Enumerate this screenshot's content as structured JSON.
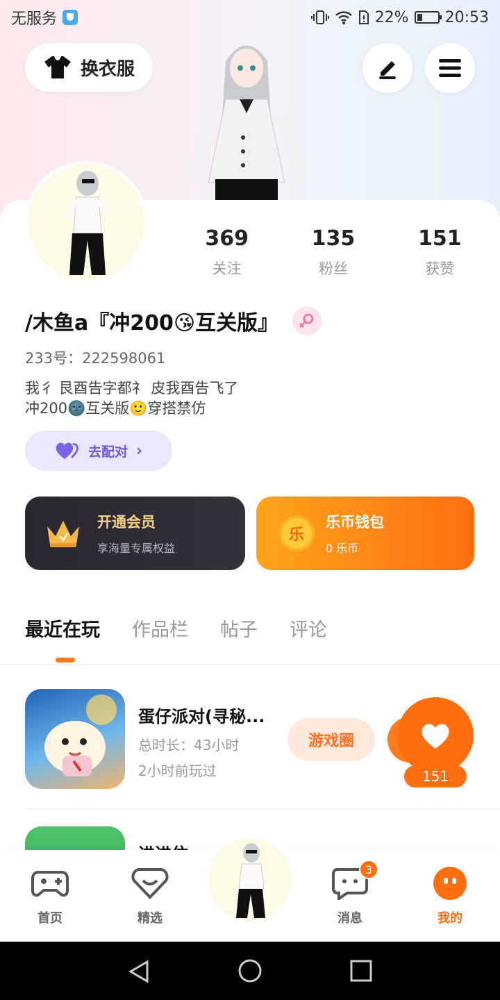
{
  "status_bar": {
    "carrier": "无服务",
    "battery": "22%",
    "time": "20:53"
  },
  "header": {
    "outfit_label": "换衣服"
  },
  "stats": [
    {
      "num": "369",
      "label": "关注"
    },
    {
      "num": "135",
      "label": "粉丝"
    },
    {
      "num": "151",
      "label": "获赞"
    }
  ],
  "profile": {
    "nickname": "/木鱼a『冲200😘互关版』",
    "uid": "233号：222598061",
    "bio_line1": "我彳 艮酉告字都礻 皮我酉告飞了",
    "bio_line2": "冲200🌚互关版🙂穿搭禁仿",
    "pair_label": "去配对"
  },
  "cards": {
    "vip_title": "开通会员",
    "vip_sub": "享海量专属权益",
    "wallet_title": "乐币钱包",
    "wallet_sub": "0 乐币",
    "coin_char": "乐"
  },
  "tabs": [
    "最近在玩",
    "作品栏",
    "帖子",
    "评论"
  ],
  "games": [
    {
      "title": "蛋仔派对(寻秘...",
      "duration": "总时长：43小时",
      "last_played": "2小时前玩过",
      "circle_label": "游戏圈",
      "likes": "151"
    },
    {
      "title": "进进住"
    }
  ],
  "bottom_nav": {
    "home": "首页",
    "featured": "精选",
    "messages": "消息",
    "messages_badge": "3",
    "me": "我的"
  },
  "colors": {
    "accent": "#ff6e0f",
    "vip_gold": "#f3d28a",
    "pair_purple": "#6c5ad6"
  }
}
